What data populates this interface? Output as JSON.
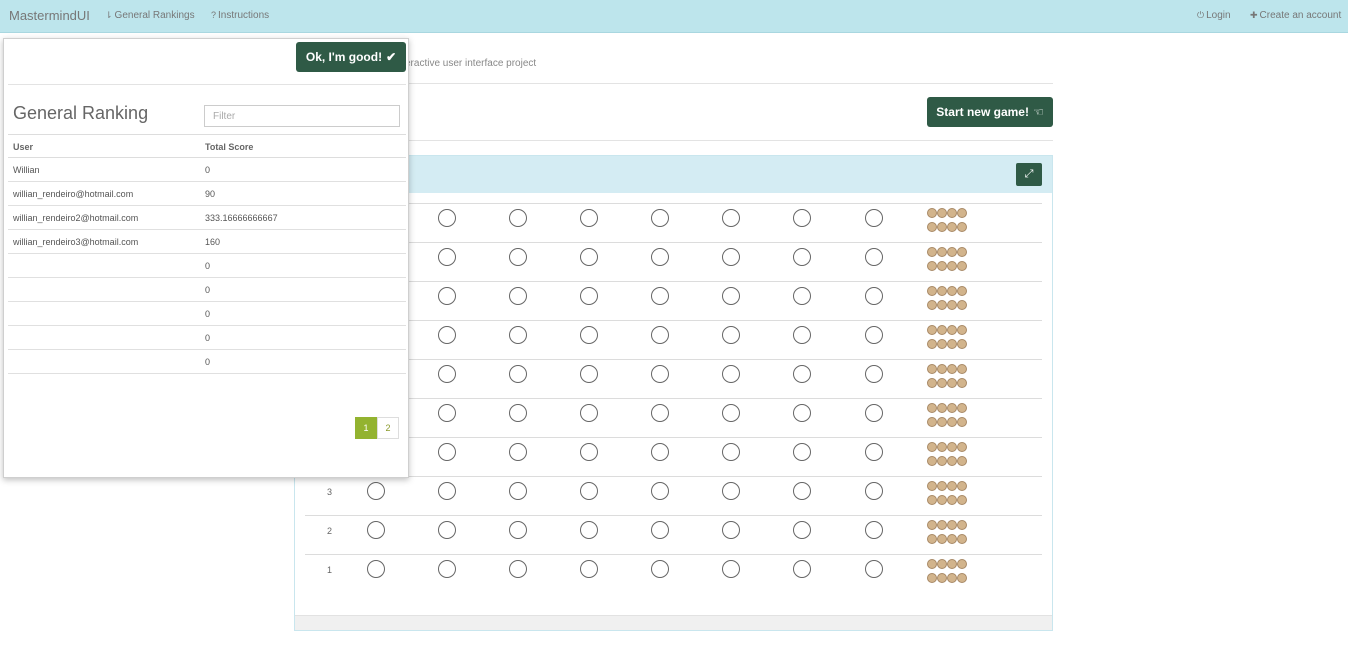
{
  "navbar": {
    "brand": "MastermindUI",
    "rankings": {
      "icon": "sort-icon",
      "label": "General Rankings"
    },
    "instructions": {
      "icon": "question-circle-icon",
      "label": "Instructions"
    },
    "login": {
      "icon": "power-icon",
      "label": "Login"
    },
    "create": {
      "icon": "plus-icon",
      "label": "Create an account"
    }
  },
  "page": {
    "subtitle": "eractive user interface project",
    "start_button": "Start new game!",
    "start_icon": "hand-pointer-icon",
    "expand_icon": "expand-icon"
  },
  "board": {
    "row_labels": [
      "",
      "",
      "",
      "",
      "",
      "",
      "",
      "3",
      "2",
      "1"
    ],
    "hint_color": "#d2b48c"
  },
  "popup": {
    "ok_button": "Ok, I'm good!",
    "ok_icon": "check-icon",
    "title": "General Ranking",
    "filter_placeholder": "Filter",
    "columns": [
      "User",
      "Total Score"
    ],
    "rows": [
      {
        "user": "Willian",
        "score": "0"
      },
      {
        "user": "willian_rendeiro@hotmail.com",
        "score": "90"
      },
      {
        "user": "willian_rendeiro2@hotmail.com",
        "score": "333.16666666667"
      },
      {
        "user": "willian_rendeiro3@hotmail.com",
        "score": "160"
      },
      {
        "user": "",
        "score": "0"
      },
      {
        "user": "",
        "score": "0"
      },
      {
        "user": "",
        "score": "0"
      },
      {
        "user": "",
        "score": "0"
      },
      {
        "user": "",
        "score": "0"
      }
    ],
    "pages": [
      "1",
      "2"
    ],
    "active_page": "1"
  },
  "colors": {
    "navbar": "#bde5ec",
    "button": "#2f5a46",
    "pager_active": "#93b330"
  }
}
